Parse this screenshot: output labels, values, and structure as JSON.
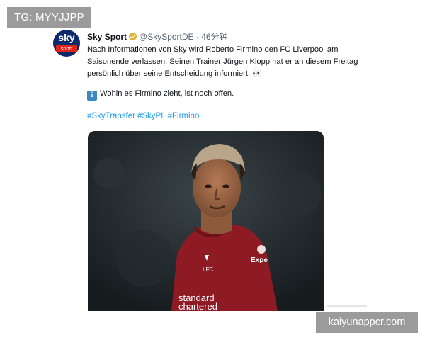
{
  "watermark_top_left": "TG: MYYJJPP",
  "watermark_bottom_right": "kaiyunappcr.com",
  "tweet": {
    "avatar": {
      "line1": "sky",
      "line2": "sport"
    },
    "author_name": "Sky Sport",
    "handle": "@SkySportDE",
    "separator": "·",
    "time": "46分钟",
    "more_icon": "···",
    "paragraphs": [
      "Nach Informationen von Sky wird Roberto Firmino den FC Liverpool am Saisonende verlassen. Seinen Trainer Jürgen Klopp hat er an diesem Freitag persönlich über seine Entscheidung informiert. 👀"
    ],
    "info_icon": "i",
    "info_text": "Wohin es Firmino zieht, ist noch offen.",
    "hashtags": [
      "#SkyTransfer",
      "#SkyPL",
      "#Firmino"
    ],
    "media": {
      "jersey_sponsor_1": "standard",
      "jersey_sponsor_2": "chartered",
      "crest_text": "LFC",
      "kit_brand": "Expe"
    }
  },
  "colors": {
    "link": "#1d9bf0",
    "text": "#0f1419",
    "muted": "#536471",
    "jersey": "#8e1b24",
    "avatar_bg": "#0b2a6b",
    "avatar_red": "#e2231a"
  }
}
